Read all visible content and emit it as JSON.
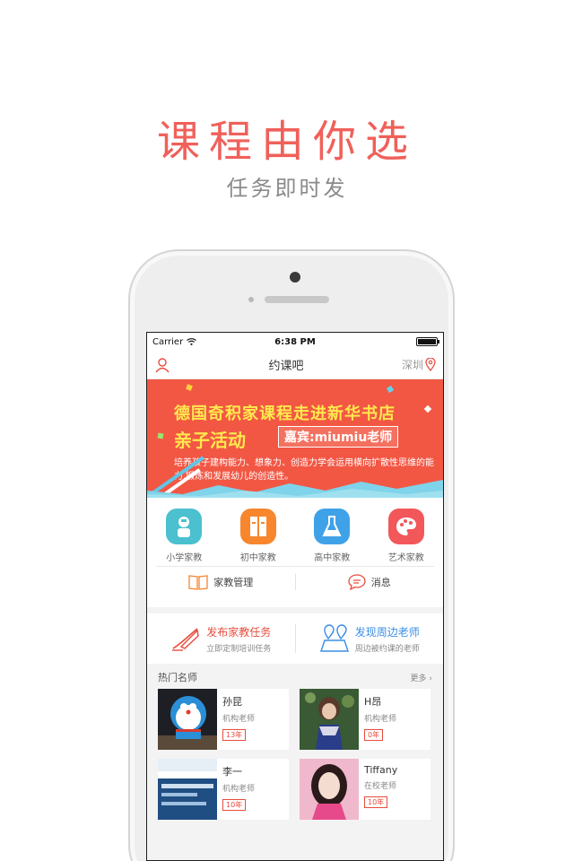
{
  "hero": {
    "title": "课程由你选",
    "subtitle": "任务即时发"
  },
  "status_bar": {
    "carrier": "Carrier",
    "time": "6:38 PM",
    "battery_percent": 100
  },
  "nav": {
    "title": "约课吧",
    "city": "深圳"
  },
  "banner": {
    "headline": "德国奇积家课程走进新华书店",
    "event": "亲子活动",
    "guest": "嘉宾:miumiu老师",
    "description": "培养孩子建构能力、想象力、创造力学会运用横向扩散性思维的能力,锻炼和发展幼儿的创造性。"
  },
  "categories": [
    {
      "label": "小学家教",
      "icon": "student-icon",
      "color": "#4bc0cf"
    },
    {
      "label": "初中家教",
      "icon": "books-icon",
      "color": "#f7862d"
    },
    {
      "label": "高中家教",
      "icon": "flask-icon",
      "color": "#3fa2e8"
    },
    {
      "label": "艺术家教",
      "icon": "palette-icon",
      "color": "#f2575a"
    }
  ],
  "manage": {
    "tutor_label": "家教管理",
    "message_label": "消息"
  },
  "tasks": [
    {
      "title": "发布家教任务",
      "sub": "立即定制培训任务",
      "icon": "pen-icon",
      "color": "#e84c3d"
    },
    {
      "title": "发现周边老师",
      "sub": "周边被约课的老师",
      "icon": "map-pin-icon",
      "color": "#3a8ee6"
    }
  ],
  "hot_teachers": {
    "heading": "热门名师",
    "more": "更多",
    "items": [
      {
        "name": "孙昆",
        "role": "机构老师",
        "years": "13年"
      },
      {
        "name": "H昂",
        "role": "机构老师",
        "years": "0年"
      },
      {
        "name": "李一",
        "role": "机构老师",
        "years": "10年"
      },
      {
        "name": "Tiffany",
        "role": "在校老师",
        "years": "10年"
      }
    ]
  }
}
